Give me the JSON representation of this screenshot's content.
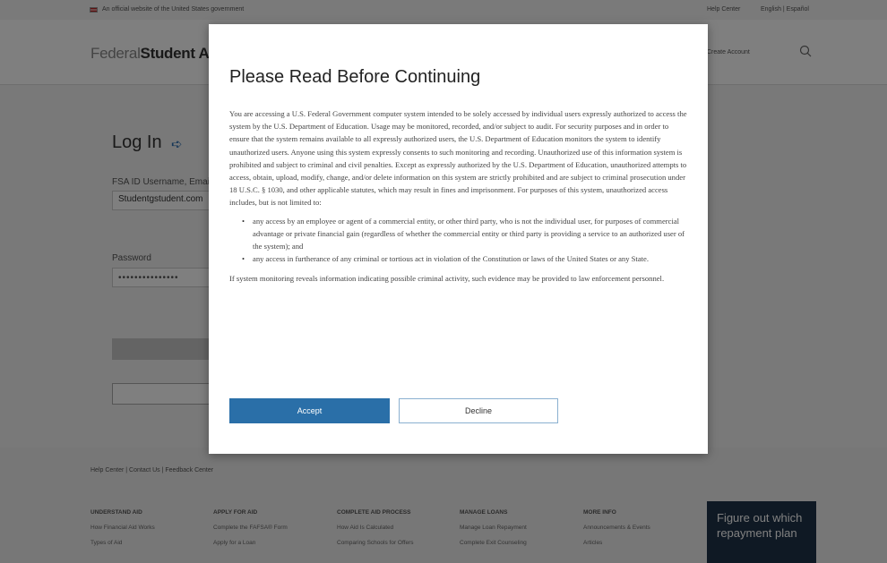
{
  "gov_banner": {
    "text": "An official website of the United States government",
    "help_link": "Help Center",
    "language_link": "English | Español"
  },
  "header": {
    "logo_federal": "Federal",
    "logo_student_aid": "Student Aid",
    "create_account": "Create Account"
  },
  "login": {
    "title": "Log In",
    "username_label": "FSA ID Username, Email, or Mobile Phone",
    "username_value": "Studentgstudent.com",
    "password_label": "Password",
    "password_value": "•••••••••••••••"
  },
  "modal": {
    "title": "Please Read Before Continuing",
    "paragraph": "You are accessing a U.S. Federal Government computer system intended to be solely accessed by individual users expressly authorized to access the system by the U.S. Department of Education. Usage may be monitored, recorded, and/or subject to audit. For security purposes and in order to ensure that the system remains available to all expressly authorized users, the U.S. Department of Education monitors the system to identify unauthorized users. Anyone using this system expressly consents to such monitoring and recording. Unauthorized use of this information system is prohibited and subject to criminal and civil penalties. Except as expressly authorized by the U.S. Department of Education, unauthorized attempts to access, obtain, upload, modify, change, and/or delete information on this system are strictly prohibited and are subject to criminal prosecution under 18 U.S.C. § 1030, and other applicable statutes, which may result in fines and imprisonment. For purposes of this system, unauthorized access includes, but is not limited to:",
    "bullets": [
      "any access by an employee or agent of a commercial entity, or other third party, who is not the individual user, for purposes of commercial advantage or private financial gain (regardless of whether the commercial entity or third party is providing a service to an authorized user of the system); and",
      "any access in furtherance of any criminal or tortious act in violation of the Constitution or laws of the United States or any State."
    ],
    "closing": "If system monitoring reveals information indicating possible criminal activity, such evidence may be provided to law enforcement personnel.",
    "accept_label": "Accept",
    "decline_label": "Decline"
  },
  "footer": {
    "links": "Help Center | Contact Us | Feedback Center",
    "columns": [
      {
        "heading": "Understand Aid",
        "items": [
          "How Financial Aid Works",
          "Types of Aid"
        ]
      },
      {
        "heading": "Apply for Aid",
        "items": [
          "Complete the FAFSA® Form",
          "Apply for a Loan"
        ]
      },
      {
        "heading": "Complete Aid Process",
        "items": [
          "How Aid Is Calculated",
          "Comparing Schools for Offers"
        ]
      },
      {
        "heading": "Manage Loans",
        "items": [
          "Manage Loan Repayment",
          "Complete Exit Counseling"
        ]
      },
      {
        "heading": "More Info",
        "items": [
          "Announcements & Events",
          "Articles"
        ]
      }
    ],
    "cta": "Figure out which repayment plan"
  }
}
